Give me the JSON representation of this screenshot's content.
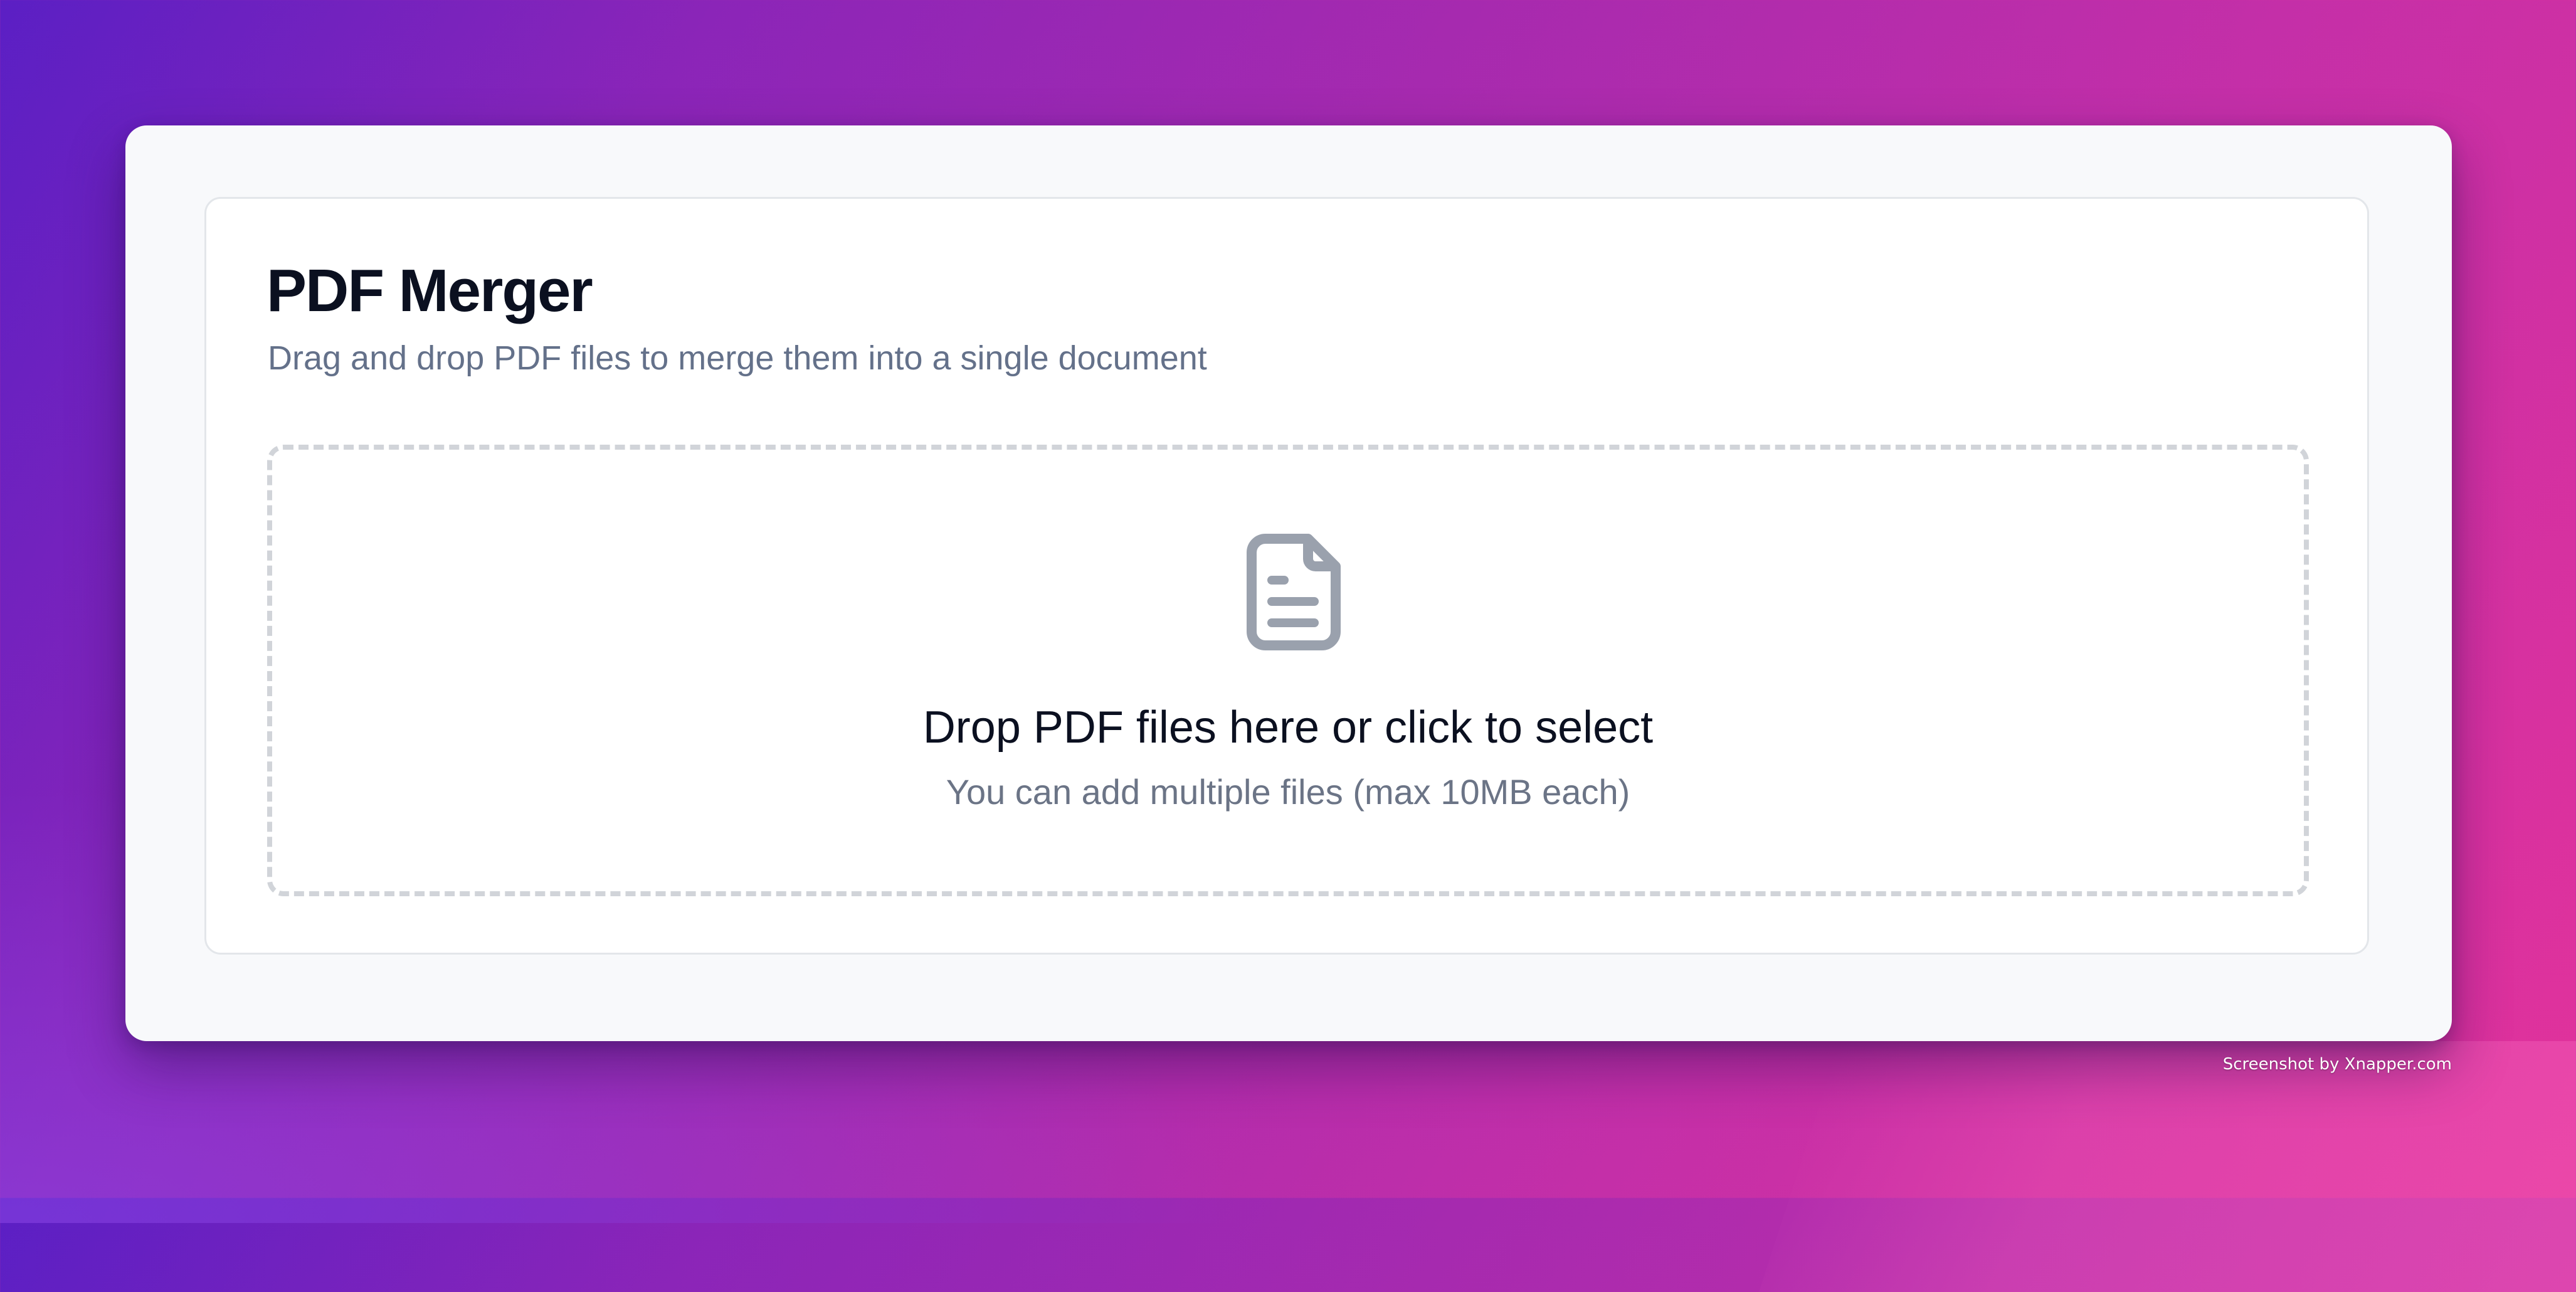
{
  "app": {
    "title": "PDF Merger",
    "subtitle": "Drag and drop PDF files to merge them into a single document"
  },
  "dropzone": {
    "icon": "file-text-icon",
    "title": "Drop PDF files here or click to select",
    "hint": "You can add multiple files (max 10MB each)"
  },
  "watermark": {
    "text": "Screenshot by Xnapper.com"
  },
  "colors": {
    "title_text": "#0b1020",
    "muted_text": "#64718a",
    "icon": "#9aa1ad",
    "dashed_border": "#d1d4d9",
    "window_bg": "#f8f9fb",
    "card_bg": "#ffffff"
  }
}
